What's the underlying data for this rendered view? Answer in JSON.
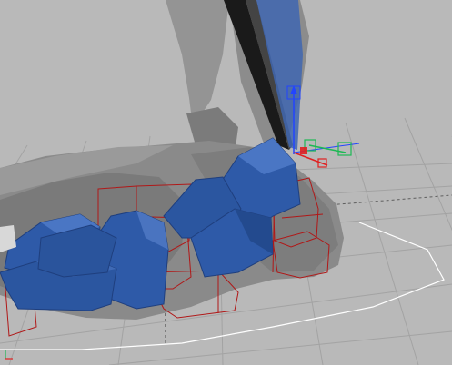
{
  "viewport": {
    "background": "#b9b9b9",
    "grid_color": "#9a9a9a",
    "grid_major_color": "#6f6f6f",
    "mesh_grey_light": "#8f8f8f",
    "mesh_grey_dark": "#6b6b6b",
    "mesh_blue": "#2e5aa8",
    "mesh_blue_dark": "#1f3f7e",
    "bbox_red": "#b01818",
    "gizmo_green": "#1db954",
    "gizmo_blue": "#2244ff",
    "gizmo_red": "#e02020",
    "selection_white": "#ffffff"
  }
}
